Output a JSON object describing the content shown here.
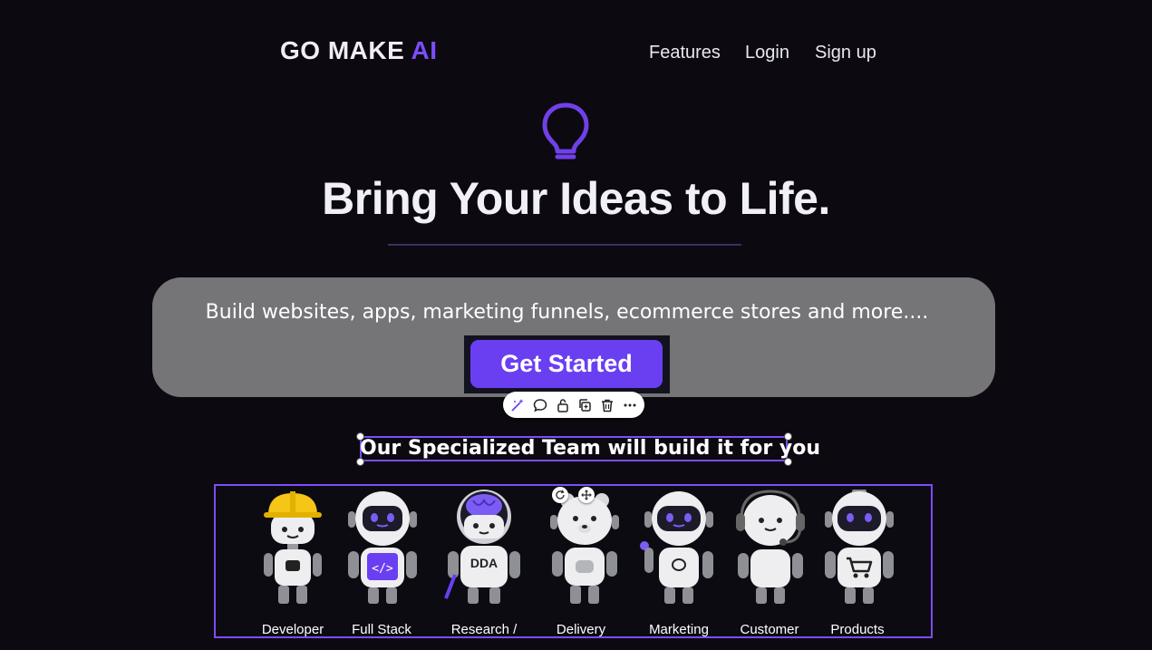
{
  "header": {
    "brand_main": "GO MAKE ",
    "brand_accent": "AI",
    "nav": [
      "Features",
      "Login",
      "Sign up"
    ]
  },
  "hero": {
    "icon": "lightbulb-icon",
    "title": "Bring Your Ideas to Life."
  },
  "card": {
    "text": "Build websites, apps, marketing funnels, ecommerce stores and more....",
    "cta_label": "Get Started"
  },
  "toolbar": {
    "icons": [
      "magic-edit-icon",
      "comment-icon",
      "lock-icon",
      "duplicate-icon",
      "trash-icon",
      "more-icon"
    ]
  },
  "team": {
    "heading": "Our Specialized Team will build it for you",
    "robots": [
      {
        "label": "Developer",
        "icon": "robot-hardhat-icon"
      },
      {
        "label": "Full Stack",
        "icon": "robot-code-icon"
      },
      {
        "label": "Research /",
        "icon": "robot-brain-icon",
        "badge": "DDA"
      },
      {
        "label": "Delivery",
        "icon": "robot-bear-icon"
      },
      {
        "label": "Marketing",
        "icon": "robot-marketing-icon"
      },
      {
        "label": "Customer",
        "icon": "robot-headset-icon"
      },
      {
        "label": "Products",
        "icon": "robot-cart-icon"
      }
    ]
  },
  "colors": {
    "background": "#0c0910",
    "accent": "#7c4dff",
    "cta": "#6a3ff2",
    "card": "#757477"
  }
}
